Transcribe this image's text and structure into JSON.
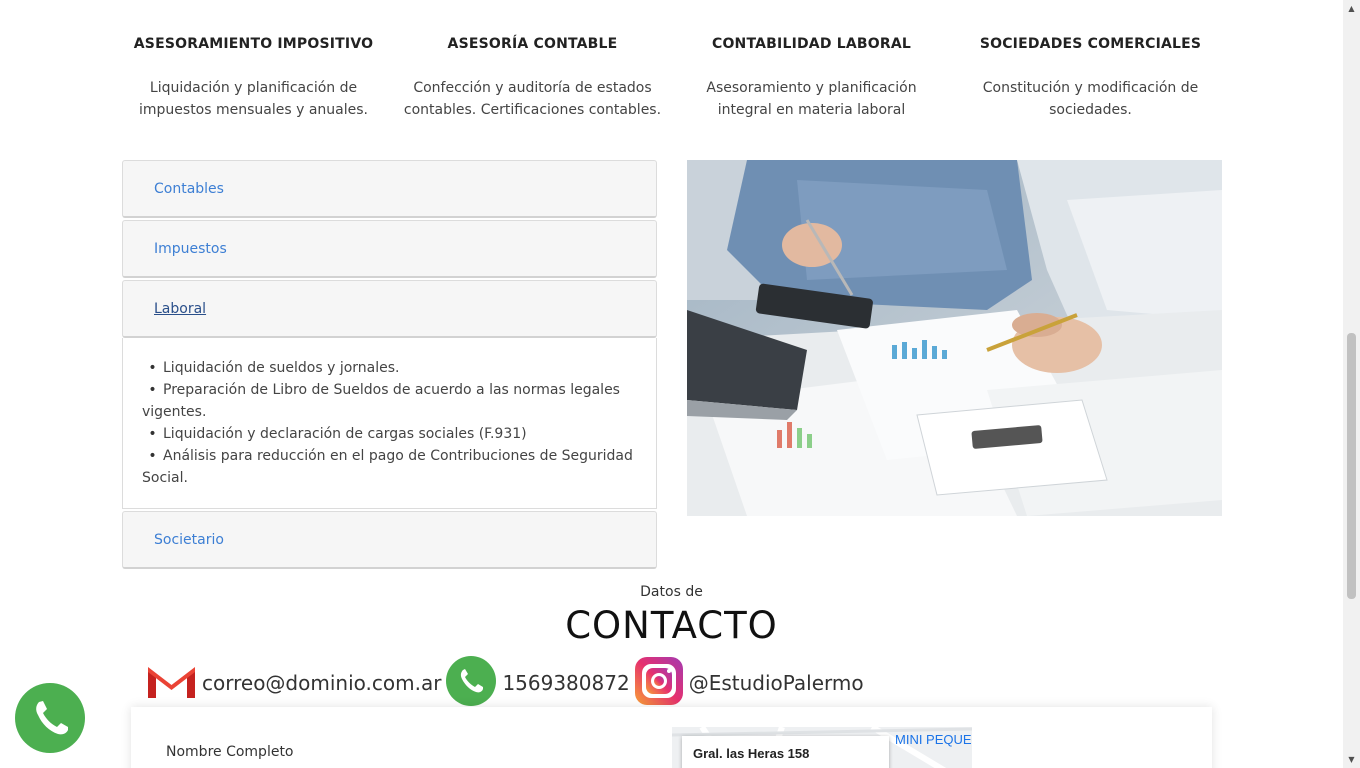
{
  "services": [
    {
      "title": "ASESORAMIENTO IMPOSITIVO",
      "desc_1": "Liquidación y planificación de",
      "desc_2": "impuestos mensuales y anuales."
    },
    {
      "title": "ASESORÍA CONTABLE",
      "desc_1": "Confección y auditoría de estados",
      "desc_2": "contables. Certificaciones contables."
    },
    {
      "title": "CONTABILIDAD LABORAL",
      "desc_1": "Asesoramiento y planificación",
      "desc_2": "integral en materia laboral"
    },
    {
      "title": "SOCIEDADES COMERCIALES",
      "desc_1": "Constitución y modificación de",
      "desc_2": "sociedades."
    }
  ],
  "accordion": {
    "items": [
      {
        "label": "Contables"
      },
      {
        "label": "Impuestos"
      },
      {
        "label": "Laboral"
      },
      {
        "label": "Societario"
      }
    ],
    "open_item": "Laboral",
    "laboral_bullets": [
      "Liquidación de sueldos y jornales.",
      "Preparación de Libro de Sueldos de acuerdo a las normas legales vigentes.",
      "Liquidación y declaración de cargas sociales (F.931)",
      "Análisis para reducción en el pago de Contribuciones de Seguridad Social."
    ]
  },
  "contact": {
    "pre_title": "Datos de",
    "title": "CONTACTO",
    "email": "correo@dominio.com.ar",
    "phone": "1569380872",
    "instagram": "@EstudioPalermo",
    "form_name_label": "Nombre Completo",
    "map_address": "Gral. las Heras 158",
    "map_place": "MINI PEQUE"
  },
  "icons": {
    "email": "gmail-icon",
    "phone": "whatsapp-icon",
    "social": "instagram-icon",
    "floating": "whatsapp-icon"
  },
  "colors": {
    "accordion_link": "#3d7fd4",
    "accordion_link_active": "#2a4f8a",
    "whatsapp": "#4caf50",
    "gmail_red": "#d93025"
  }
}
